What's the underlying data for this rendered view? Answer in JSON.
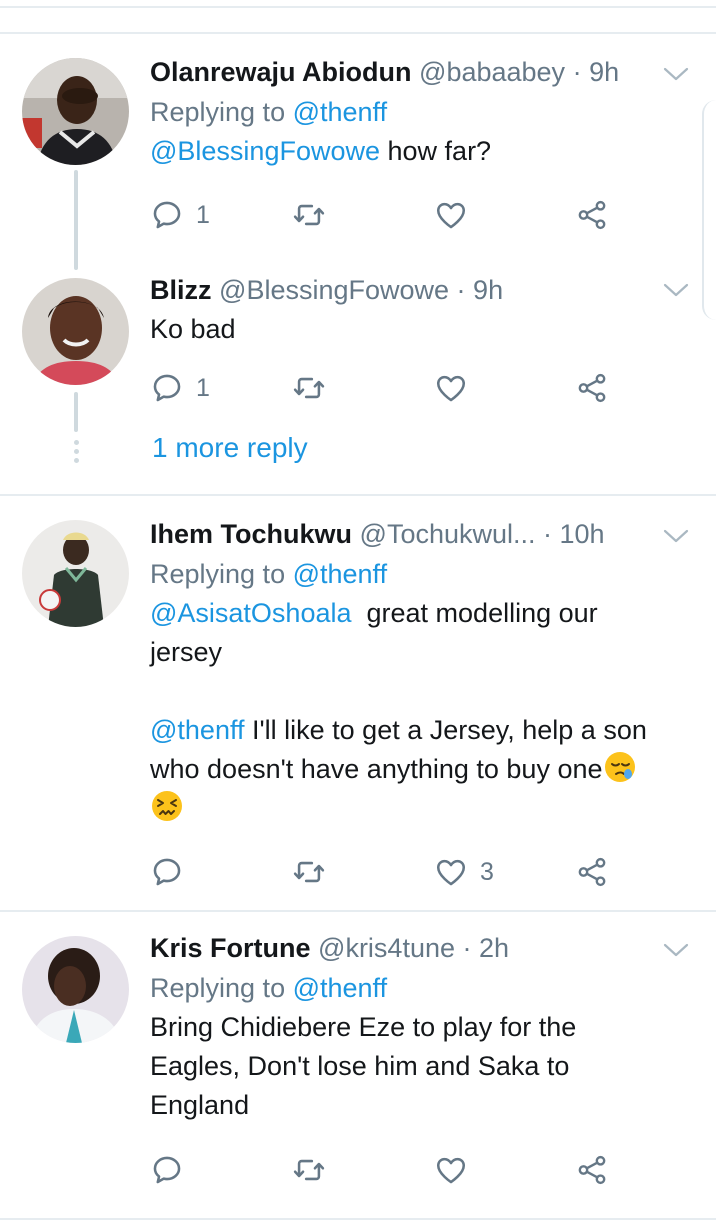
{
  "tweets": [
    {
      "name": "Olanrewaju Abiodun",
      "handle": "@babaabey",
      "sep": " · ",
      "time": "9h",
      "reply_prefix": "Replying to ",
      "reply_to": "@thenff",
      "mention": "@BlessingFowowe",
      "body": " how far?",
      "reply_count": "1",
      "retweet_count": "",
      "like_count": ""
    },
    {
      "name": "Blizz",
      "handle": "@BlessingFowowe",
      "sep": " · ",
      "time": "9h",
      "body": "Ko bad",
      "reply_count": "1",
      "retweet_count": "",
      "like_count": "",
      "more_replies": "1 more reply"
    },
    {
      "name": "Ihem Tochukwu",
      "handle": "@Tochukwul...",
      "sep": " · ",
      "time": "10h",
      "reply_prefix": "Replying to ",
      "reply_to": "@thenff",
      "mention": "@AsisatOshoala",
      "body_line1": "  great modelling our",
      "body_line2": "jersey",
      "mention2": "@thenff",
      "body2_line1": " I'll like to get a Jersey, help a son",
      "body2_line2": "who doesn't have anything to buy one",
      "reply_count": "",
      "retweet_count": "",
      "like_count": "3"
    },
    {
      "name": "Kris Fortune",
      "handle": "@kris4tune",
      "sep": " · ",
      "time": "2h",
      "reply_prefix": "Replying to ",
      "reply_to": "@thenff",
      "body_line1": "Bring Chidiebere Eze to play for the",
      "body_line2": "Eagles, Don't lose him and Saka to",
      "body_line3": "England",
      "reply_count": "",
      "retweet_count": "",
      "like_count": ""
    }
  ],
  "icons": {
    "reply": "reply-icon",
    "retweet": "retweet-icon",
    "like": "heart-icon",
    "share": "share-icon",
    "menu": "chevron-down-icon",
    "emoji_sleepy": "sleepy-face-emoji",
    "emoji_confounded": "confounded-face-emoji"
  },
  "colors": {
    "link": "#1b95e0",
    "secondary": "#657786",
    "divider": "#e6ecf0",
    "thread": "#cfd9de"
  }
}
